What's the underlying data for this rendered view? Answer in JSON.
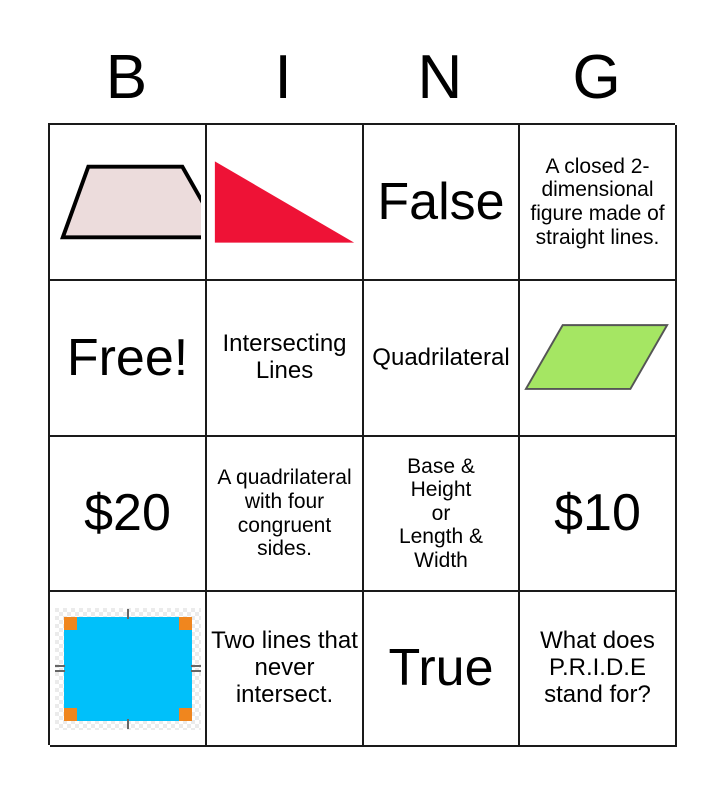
{
  "header": {
    "letters": [
      "B",
      "I",
      "N",
      "G"
    ]
  },
  "colors": {
    "grid_line": "#1a1a1a",
    "background": "#ffffff",
    "trapezoid_fill": "#ecdcdc",
    "trapezoid_stroke": "#000000",
    "triangle_fill": "#ee1236",
    "parallelogram_fill": "#a5e663",
    "parallelogram_stroke": "#555555",
    "rectangle_fill": "#00c0fa",
    "handle_fill": "#f0861e",
    "checker_light": "#ffffff",
    "checker_dark": "#ebebeb"
  },
  "grid": {
    "rows": 4,
    "columns": 4,
    "cells": [
      {
        "row": 1,
        "col": 1,
        "type": "shape",
        "shape": "trapezoid",
        "text": ""
      },
      {
        "row": 1,
        "col": 2,
        "type": "shape",
        "shape": "right-triangle",
        "text": ""
      },
      {
        "row": 1,
        "col": 3,
        "type": "text",
        "size": "huge",
        "text": "False"
      },
      {
        "row": 1,
        "col": 4,
        "type": "text",
        "size": "small",
        "text": "A closed 2-dimensional figure made of straight lines."
      },
      {
        "row": 2,
        "col": 1,
        "type": "text",
        "size": "huge",
        "text": "Free!"
      },
      {
        "row": 2,
        "col": 2,
        "type": "text",
        "size": "medium",
        "text": "Intersecting Lines"
      },
      {
        "row": 2,
        "col": 3,
        "type": "text",
        "size": "medium",
        "text": "Quadrilateral"
      },
      {
        "row": 2,
        "col": 4,
        "type": "shape",
        "shape": "parallelogram",
        "text": ""
      },
      {
        "row": 3,
        "col": 1,
        "type": "text",
        "size": "huge",
        "text": "$20"
      },
      {
        "row": 3,
        "col": 2,
        "type": "text",
        "size": "small",
        "text": "A quadrilateral with four congruent sides."
      },
      {
        "row": 3,
        "col": 3,
        "type": "text",
        "size": "small",
        "text": "Base &\nHeight\nor\nLength &\nWidth"
      },
      {
        "row": 3,
        "col": 4,
        "type": "text",
        "size": "huge",
        "text": "$10"
      },
      {
        "row": 4,
        "col": 1,
        "type": "shape",
        "shape": "selected-rectangle",
        "text": ""
      },
      {
        "row": 4,
        "col": 2,
        "type": "text",
        "size": "medium",
        "text": "Two lines that never intersect."
      },
      {
        "row": 4,
        "col": 3,
        "type": "text",
        "size": "huge",
        "text": "True"
      },
      {
        "row": 4,
        "col": 4,
        "type": "text",
        "size": "medium",
        "text": "What does P.R.I.D.E stand for?"
      }
    ]
  }
}
